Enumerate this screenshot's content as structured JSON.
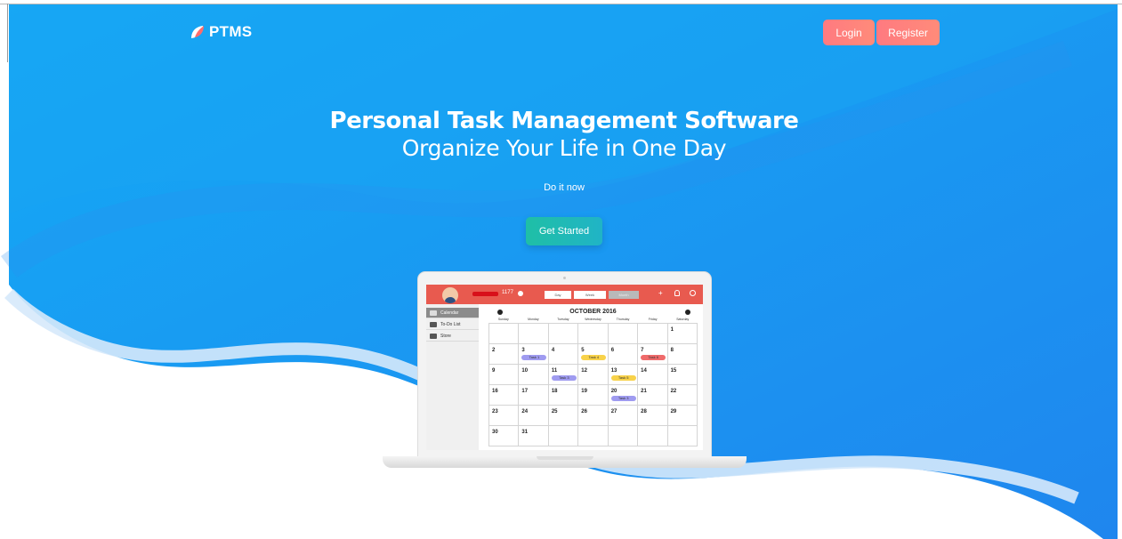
{
  "brand": {
    "name": "PTMS",
    "logo_icon": "leaf-icon"
  },
  "nav": {
    "login_label": "Login",
    "register_label": "Register"
  },
  "hero": {
    "title": "Personal Task Management Software",
    "subtitle": "Organize Your Life in One Day",
    "tagline": "Do it now",
    "cta_label": "Get Started"
  },
  "colors": {
    "background_start": "#12a6f2",
    "background_end": "#1c86ee",
    "auth_button": "#ff7f7e",
    "cta_button": "#20bab4",
    "app_header": "#e85a4f"
  },
  "preview": {
    "coins": "1177",
    "views": {
      "day": "Day",
      "week": "Week",
      "month": "Month"
    },
    "sidebar": [
      {
        "label": "Calendar",
        "icon": "calendar-icon",
        "active": true
      },
      {
        "label": "To-Do List",
        "icon": "list-icon",
        "active": false
      },
      {
        "label": "Store",
        "icon": "store-icon",
        "active": false
      }
    ],
    "calendar": {
      "month": "OCTOBER 2016",
      "weekdays": [
        "Sunday",
        "Monday",
        "Tuesday",
        "Wednesday",
        "Thursday",
        "Friday",
        "Saturday"
      ],
      "weeks": [
        [
          null,
          null,
          null,
          null,
          null,
          null,
          1
        ],
        [
          2,
          3,
          4,
          5,
          6,
          7,
          8
        ],
        [
          9,
          10,
          11,
          12,
          13,
          14,
          15
        ],
        [
          16,
          17,
          18,
          19,
          20,
          21,
          22
        ],
        [
          23,
          24,
          25,
          26,
          27,
          28,
          29
        ],
        [
          30,
          31,
          null,
          null,
          null,
          null,
          null
        ]
      ],
      "tasks": [
        {
          "label": "Task 1",
          "day": 3,
          "color": "#9f9bf0"
        },
        {
          "label": "Task 4",
          "day": 5,
          "color": "#f8d24a"
        },
        {
          "label": "Task 6",
          "day": 7,
          "color": "#ef6a6a"
        },
        {
          "label": "Task 3",
          "day": 11,
          "color": "#9f9bf0"
        },
        {
          "label": "Task 5",
          "day": 13,
          "color": "#f8d24a"
        },
        {
          "label": "Task 3",
          "day": 20,
          "color": "#9f9bf0"
        }
      ]
    }
  }
}
